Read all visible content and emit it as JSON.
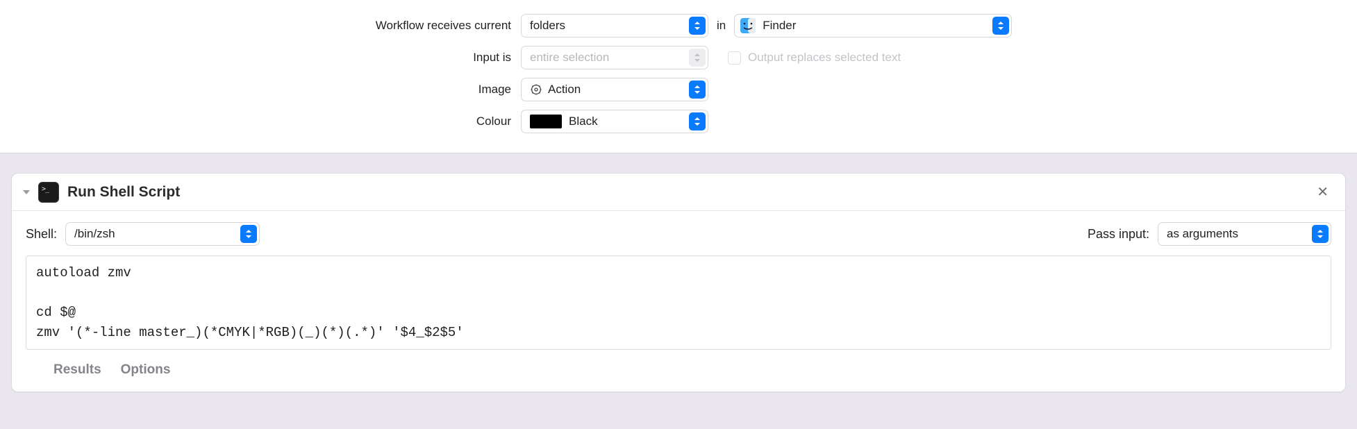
{
  "top": {
    "receives_label": "Workflow receives current",
    "receives_value": "folders",
    "in_label": "in",
    "app_value": "Finder",
    "input_is_label": "Input is",
    "input_is_value": "entire selection",
    "output_replaces_label": "Output replaces selected text",
    "image_label": "Image",
    "image_value": "Action",
    "colour_label": "Colour",
    "colour_value": "Black"
  },
  "action": {
    "title": "Run Shell Script",
    "shell_label": "Shell:",
    "shell_value": "/bin/zsh",
    "pass_label": "Pass input:",
    "pass_value": "as arguments",
    "script": "autoload zmv\n\ncd $@\nzmv '(*-line master_)(*CMYK|*RGB)(_)(*)(.*)' '$4_$2$5'",
    "results_tab": "Results",
    "options_tab": "Options"
  }
}
